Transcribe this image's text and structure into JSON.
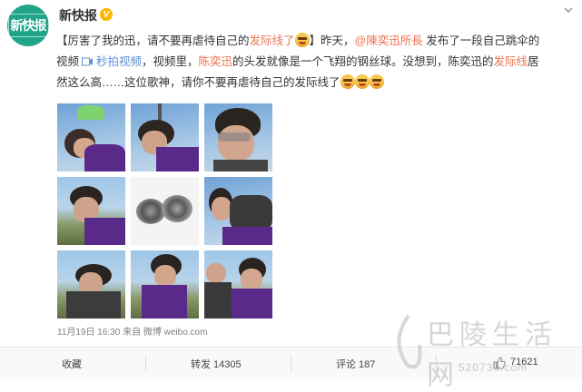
{
  "post": {
    "avatar_text": "新快报",
    "username": "新快报",
    "verified_mark": "V",
    "text": {
      "line1_part1": "【厉害了我的迅，请不要再虐待自己的",
      "line1_link1": "发际线了",
      "line1_part2": "】昨天，",
      "line1_mention": "@陳奕迅所長",
      "line1_part3": " 发布了一段自己跳伞的",
      "line2_part1": "视频 ",
      "line2_video_link": "秒拍视频",
      "line2_part2": "，视频里，",
      "line2_link2": "陈奕迅",
      "line2_part3": "的头发就像是一个飞翔的钢丝球。没想到，陈奕迅的",
      "line2_link3": "发际线",
      "line2_part4": "居",
      "line3_part1": "然这么高……这位歌神，请你不要再虐待自己的发际线了"
    },
    "meta": "11月19日 16:30 来自 微博 weibo.com",
    "photos": [
      {
        "name": "photo-skydive-1"
      },
      {
        "name": "photo-skydive-2"
      },
      {
        "name": "photo-skydive-3"
      },
      {
        "name": "photo-skydive-4"
      },
      {
        "name": "photo-steel-wool"
      },
      {
        "name": "photo-skydive-5"
      },
      {
        "name": "photo-skydive-6"
      },
      {
        "name": "photo-skydive-7"
      },
      {
        "name": "photo-skydive-8"
      }
    ]
  },
  "actions": {
    "favorite": "收藏",
    "repost": "转发 14305",
    "comment": "评论 187",
    "like": "71621"
  },
  "watermark": {
    "text": "巴陵生活网",
    "url": "520730.com"
  },
  "colors": {
    "brand": "#20a58a",
    "link": "#eb7350",
    "video_link": "#5a8fd6"
  }
}
